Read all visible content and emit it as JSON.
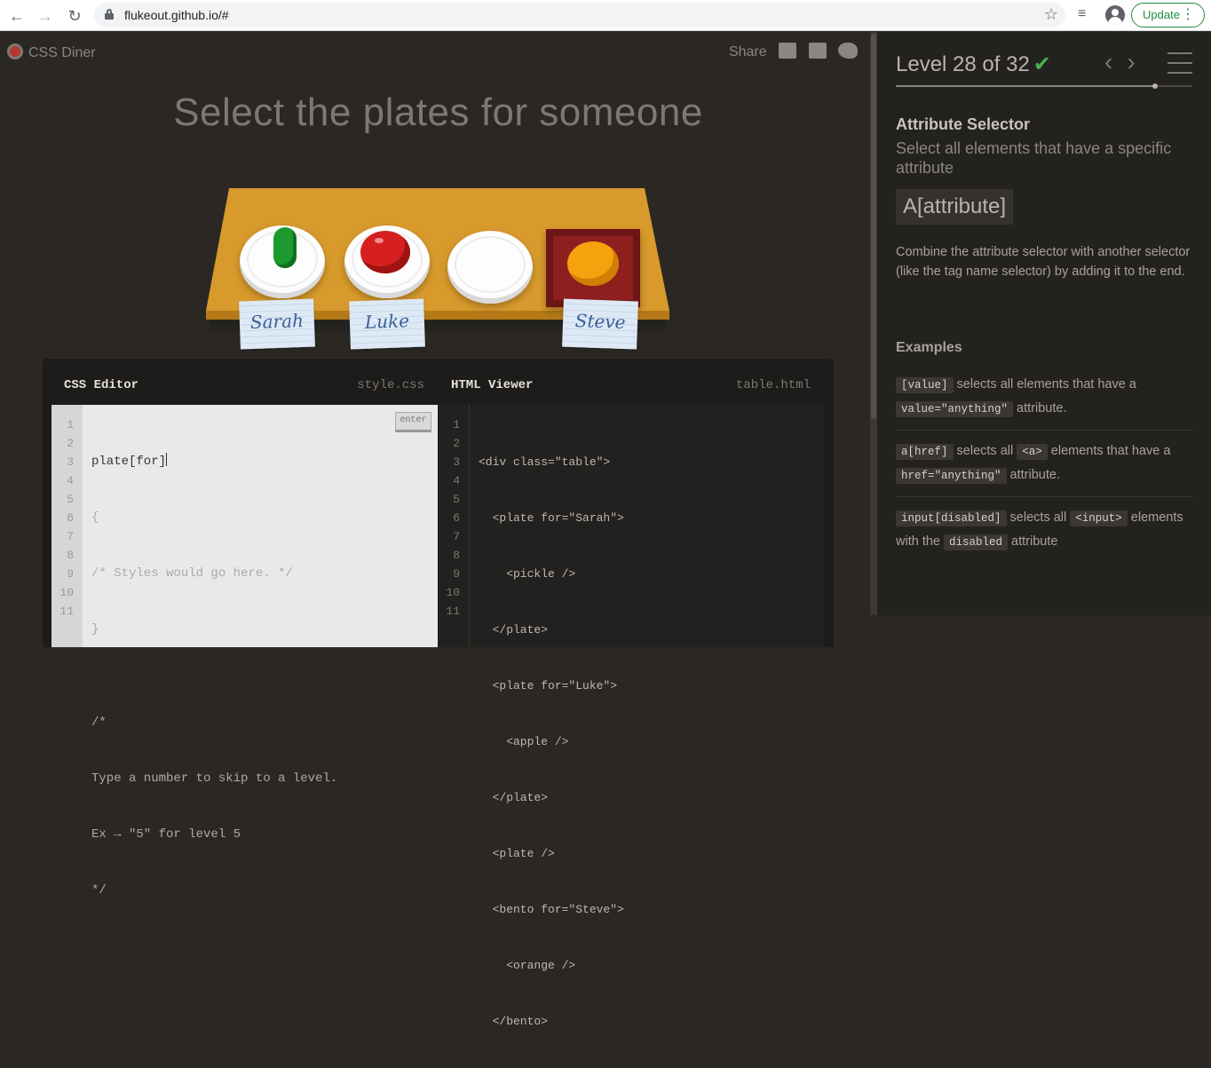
{
  "browser": {
    "url": "flukeout.github.io/#",
    "update_label": "Update"
  },
  "header": {
    "logo_text": "CSS Diner",
    "share_label": "Share"
  },
  "title": "Select the plates for someone",
  "table": {
    "tags": [
      "Sarah",
      "Luke",
      "Steve"
    ]
  },
  "editor": {
    "css_title": "CSS Editor",
    "css_file": "style.css",
    "html_title": "HTML Viewer",
    "html_file": "table.html",
    "enter_label": "enter",
    "css_input": "plate[for]",
    "css_lines": [
      "{",
      "/* Styles would go here. */",
      "}",
      "",
      "/*",
      "Type a number to skip to a level.",
      "Ex → \"5\" for level 5",
      "*/",
      "",
      ""
    ],
    "html_lines": [
      "<div class=\"table\">",
      "  <plate for=\"Sarah\">",
      "    <pickle />",
      "  </plate>",
      "  <plate for=\"Luke\">",
      "    <apple />",
      "  </plate>",
      "  <plate />",
      "  <bento for=\"Steve\">",
      "    <orange />",
      "  </bento>"
    ]
  },
  "sidebar": {
    "level_text": "Level 28 of 32",
    "check": "✔",
    "progress": 0.875,
    "selector_name": "Attribute Selector",
    "selector_title": "Select all elements that have a specific attribute",
    "syntax": "A[attribute]",
    "hint": "Combine the attribute selector with another selector (like the tag name selector) by adding it to the end.",
    "examples_heading": "Examples",
    "examples": [
      {
        "code": "[value]",
        "text1": " selects all elements that have a ",
        "code2": "value=\"anything\"",
        "text2": " attribute."
      },
      {
        "code": "a[href]",
        "text1": " selects all ",
        "code2": "<a>",
        "text2": " elements that have a ",
        "code3": "href=\"anything\"",
        "text3": " attribute."
      },
      {
        "code": "input[disabled]",
        "text1": " selects all ",
        "code2": "<input>",
        "text2": " elements with the ",
        "code3": "disabled",
        "text3": " attribute"
      }
    ]
  }
}
